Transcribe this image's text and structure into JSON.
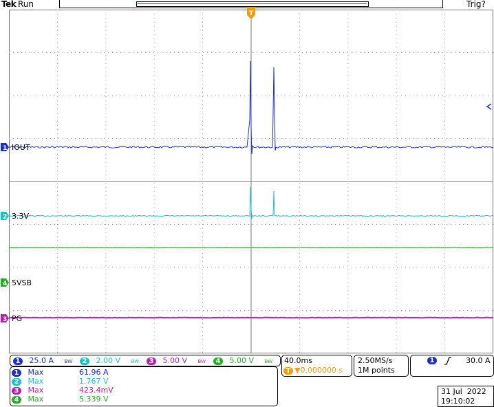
{
  "header": {
    "brand": "Tek",
    "state": "Run",
    "trigger_status": "Trig?"
  },
  "channels": [
    {
      "id": "1",
      "label": "IOUT",
      "color": "#1c2fc7"
    },
    {
      "id": "2",
      "label": "3.3V",
      "color": "#19c2c9"
    },
    {
      "id": "3",
      "label": "PG",
      "color": "#b31fb3"
    },
    {
      "id": "4",
      "label": "5VSB",
      "color": "#22b022"
    }
  ],
  "settings": {
    "ch1_scale": "25.0 A",
    "ch2_scale": "2.00 V",
    "ch3_scale": "5.00 V",
    "ch4_scale": "5.00 V",
    "bw_mark": "BW",
    "timebase": "40.0ms",
    "trigger_position": "▼0.000000 s",
    "sample_rate": "2.50MS/s",
    "record_length": "1M points",
    "trigger_channel": "1",
    "trigger_slope_icon": "rising-edge-icon",
    "trigger_level": "30.0 A"
  },
  "measurements": [
    {
      "ch": "1",
      "name": "Max",
      "value": "61.96 A",
      "color": "#1c2fc7"
    },
    {
      "ch": "2",
      "name": "Max",
      "value": "1.767 V",
      "color": "#19c2c9"
    },
    {
      "ch": "3",
      "name": "Max",
      "value": "423.4mV",
      "color": "#b31fb3"
    },
    {
      "ch": "4",
      "name": "Max",
      "value": "5.339 V",
      "color": "#22b022"
    }
  ],
  "datetime": {
    "date": "31 Jul  2022",
    "time": "19:10:02"
  },
  "trigger_marker": {
    "label": "T",
    "color": "#f39c12"
  }
}
